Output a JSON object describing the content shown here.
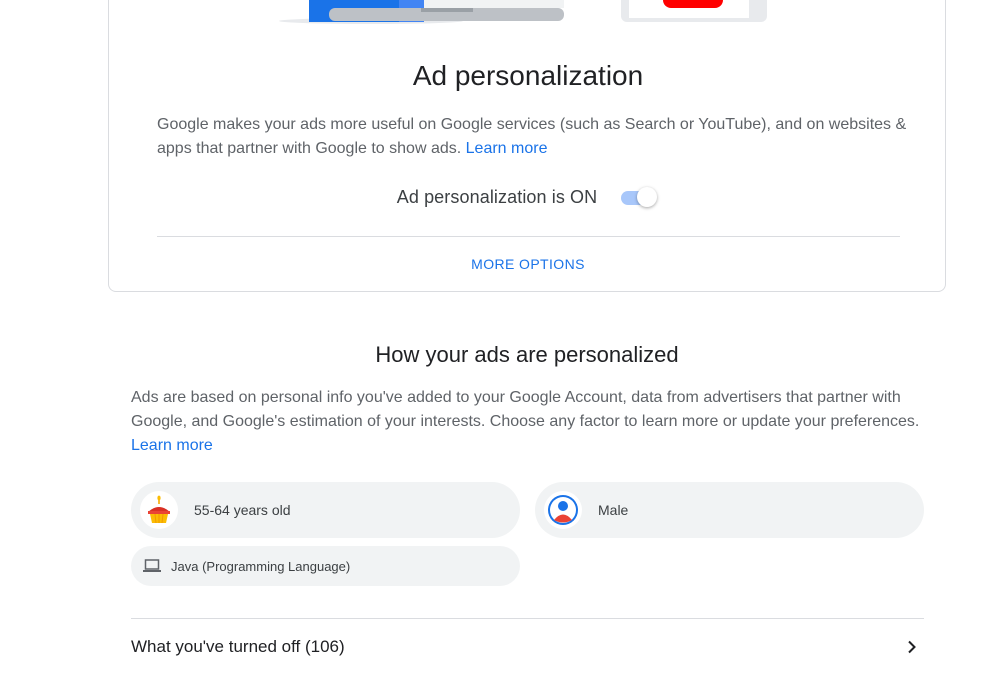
{
  "ad_personalization": {
    "title": "Ad personalization",
    "description": "Google makes your ads more useful on Google services (such as Search or YouTube), and on websites & apps that partner with Google to show ads.",
    "learn_more": "Learn more",
    "toggle_label": "Ad personalization is ON",
    "toggle_on": true,
    "more_options": "MORE OPTIONS"
  },
  "how_personalized": {
    "title": "How your ads are personalized",
    "description": "Ads are based on personal info you've added to your Google Account, data from advertisers that partner with Google, and Google's estimation of your interests. Choose any factor to learn more or update your preferences.",
    "learn_more": "Learn more",
    "factors": [
      {
        "label": "55-64 years old",
        "icon": "birthday-cake-icon"
      },
      {
        "label": "Male",
        "icon": "person-avatar-icon"
      },
      {
        "label": "Java (Programming Language)",
        "icon": "laptop-icon"
      }
    ]
  },
  "turned_off": {
    "label": "What you've turned off (106)"
  },
  "colors": {
    "accent": "#1a73e8",
    "chip_bg": "#f1f3f4",
    "toggle_track": "#a8c7fa",
    "youtube_red": "#ff0000"
  }
}
